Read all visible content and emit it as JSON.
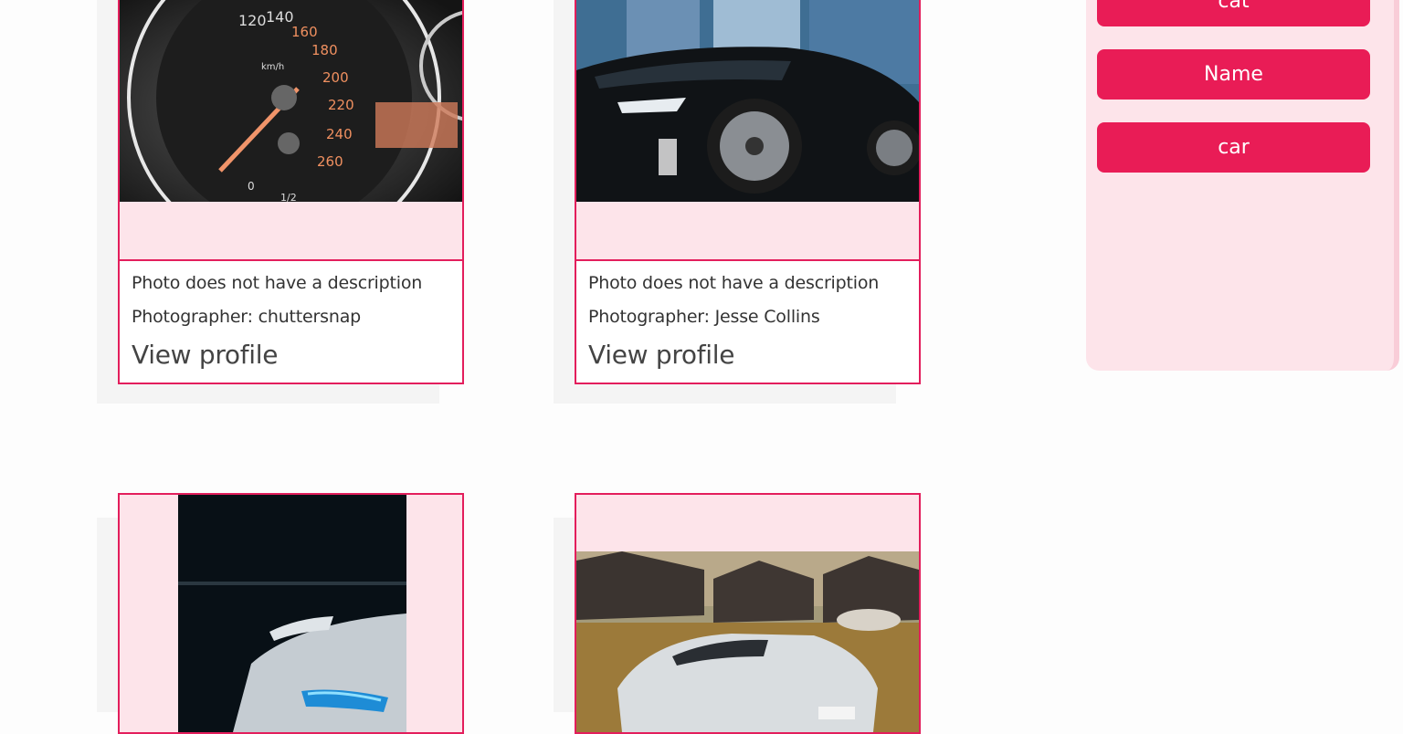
{
  "cards": [
    {
      "description": "Photo does not have a description",
      "photographer": "Photographer: chuttersnap",
      "profile_link": "View profile"
    },
    {
      "description": "Photo does not have a description",
      "photographer": "Photographer: Jesse Collins",
      "profile_link": "View profile"
    },
    {
      "description": "",
      "photographer": "",
      "profile_link": ""
    },
    {
      "description": "",
      "photographer": "",
      "profile_link": ""
    }
  ],
  "speedometer_labels": [
    "120",
    "140",
    "160",
    "180",
    "200",
    "220",
    "240",
    "260",
    "km/h",
    "0",
    "1/2"
  ],
  "sidebar": {
    "tags": [
      {
        "label": "cat"
      },
      {
        "label": "Name"
      },
      {
        "label": "car"
      }
    ]
  },
  "colors": {
    "accent": "#e91c56",
    "card_border": "#e31e5c",
    "card_bg": "#fde4ea",
    "sidebar_bg": "#fde4ea"
  }
}
